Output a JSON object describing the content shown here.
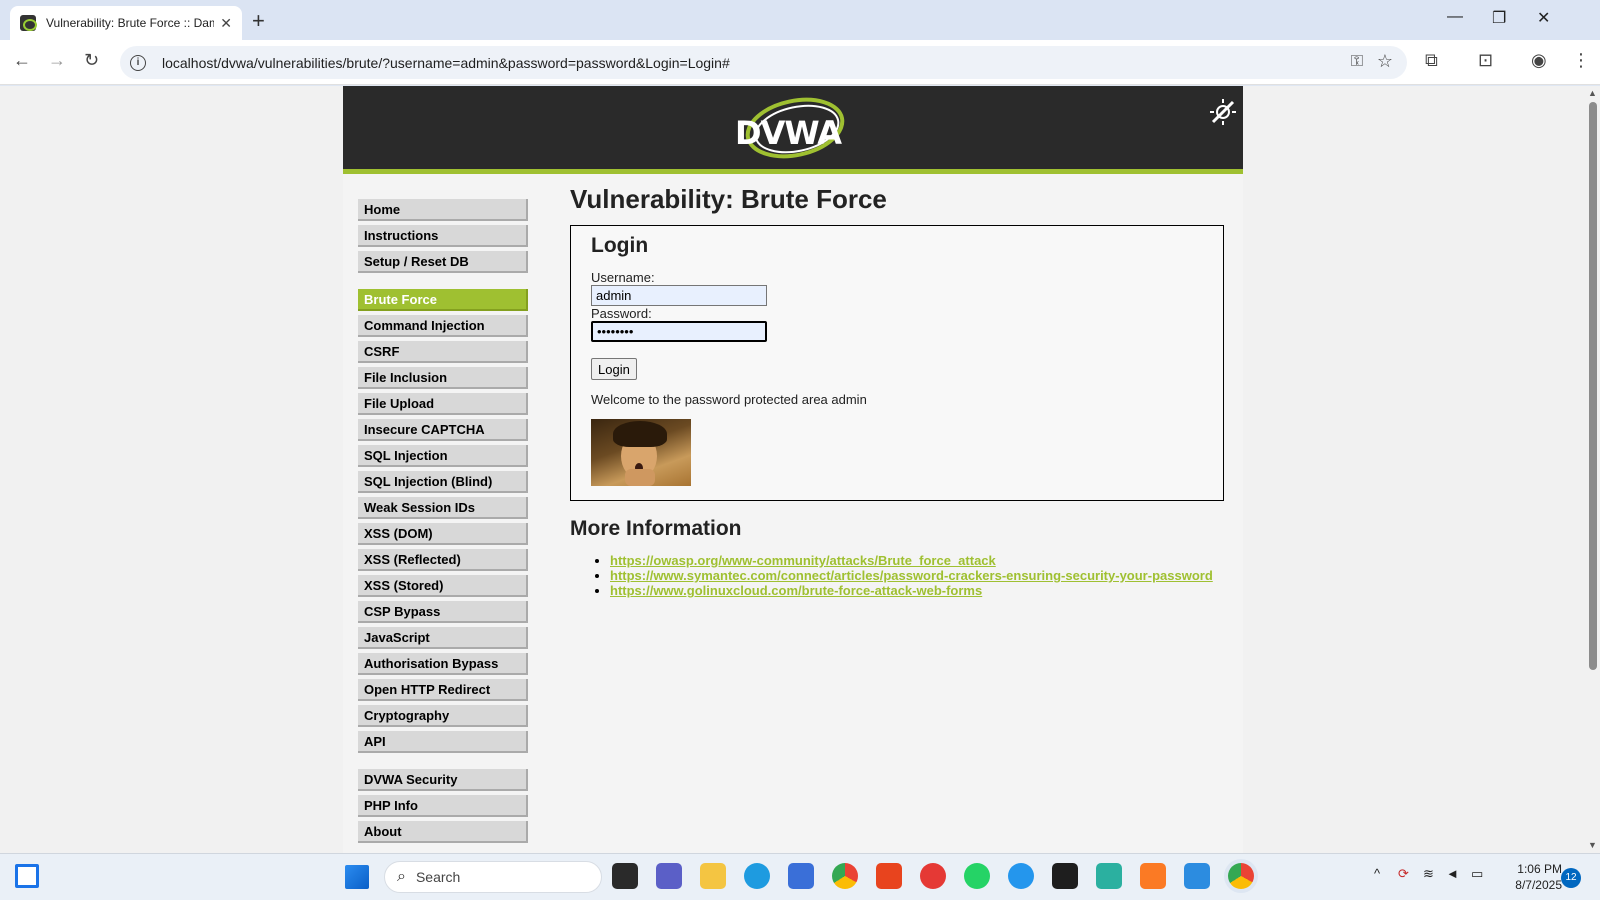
{
  "browser": {
    "tab_title": "Vulnerability: Brute Force :: Dam",
    "url": "localhost/dvwa/vulnerabilities/brute/?username=admin&password=password&Login=Login#"
  },
  "header": {
    "logo_text": "DVWA"
  },
  "sidebar": {
    "group1": [
      "Home",
      "Instructions",
      "Setup / Reset DB"
    ],
    "group2": [
      "Brute Force",
      "Command Injection",
      "CSRF",
      "File Inclusion",
      "File Upload",
      "Insecure CAPTCHA",
      "SQL Injection",
      "SQL Injection (Blind)",
      "Weak Session IDs",
      "XSS (DOM)",
      "XSS (Reflected)",
      "XSS (Stored)",
      "CSP Bypass",
      "JavaScript",
      "Authorisation Bypass",
      "Open HTTP Redirect",
      "Cryptography",
      "API"
    ],
    "group3": [
      "DVWA Security",
      "PHP Info",
      "About"
    ],
    "selected": "Brute Force"
  },
  "main": {
    "title": "Vulnerability: Brute Force",
    "login_heading": "Login",
    "username_label": "Username:",
    "username_value": "admin",
    "password_label": "Password:",
    "password_value": "password",
    "login_button": "Login",
    "welcome": "Welcome to the password protected area admin",
    "more_info_heading": "More Information",
    "links": [
      "https://owasp.org/www-community/attacks/Brute_force_attack",
      "https://www.symantec.com/connect/articles/password-crackers-ensuring-security-your-password",
      "https://www.golinuxcloud.com/brute-force-attack-web-forms"
    ]
  },
  "taskbar": {
    "search_placeholder": "Search",
    "time": "1:06 PM",
    "date": "8/7/2025",
    "notification_count": "12"
  },
  "colors": {
    "dvwa_green": "#9fc031",
    "header_dark": "#2a2a2a"
  }
}
